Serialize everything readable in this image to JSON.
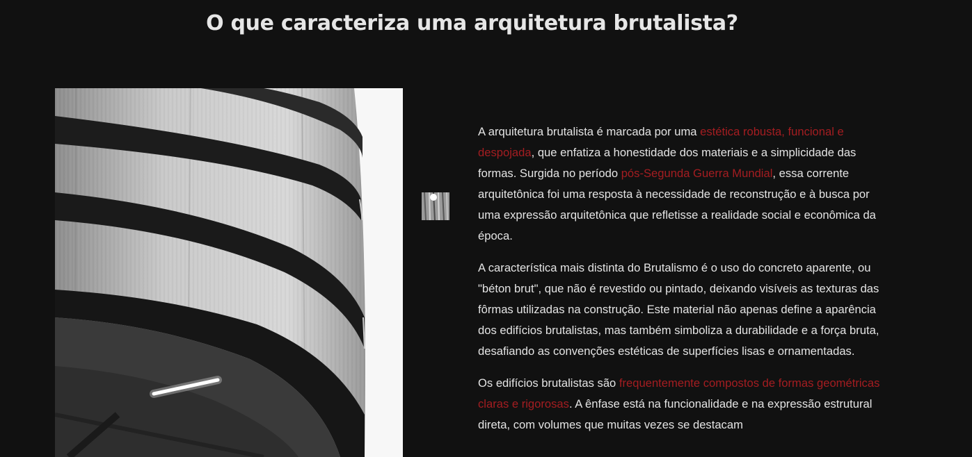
{
  "page": {
    "title": "O que caracteriza uma arquitetura brutalista?"
  },
  "image": {
    "subject": "brutalist concrete spiral building"
  },
  "thumbnail": {
    "subject": "concrete texture thumbnail"
  },
  "colors": {
    "background": "#111111",
    "text": "#e4e4e4",
    "highlight": "#a41d21"
  },
  "article": {
    "p1": {
      "t1": "A arquitetura brutalista é marcada por uma ",
      "h1": "estética robusta, funcional e despojada",
      "t2": ", que enfatiza a honestidade dos materiais e a simplicidade das formas. Surgida no período ",
      "h2": "pós-Segunda Guerra Mundial",
      "t3": ", essa corrente arquitetônica foi uma resposta à necessidade de reconstrução e à busca por uma expressão arquitetônica que refletisse a realidade social e econômica da época."
    },
    "p2": {
      "t1": "A característica mais distinta do Brutalismo é o uso do concreto aparente, ou \"béton brut\", que não é revestido ou pintado, deixando visíveis as texturas das fôrmas utilizadas na construção. Este material não apenas define a aparência dos edifícios brutalistas, mas também simboliza a durabilidade e a força bruta, desafiando as convenções estéticas de superfícies lisas e ornamentadas."
    },
    "p3": {
      "t1": "Os edifícios brutalistas são ",
      "h1": "frequentemente compostos de formas geométricas claras e rigorosas",
      "t2": ". A ênfase está na funcionalidade e na expressão estrutural direta, com volumes que muitas vezes se destacam"
    }
  }
}
